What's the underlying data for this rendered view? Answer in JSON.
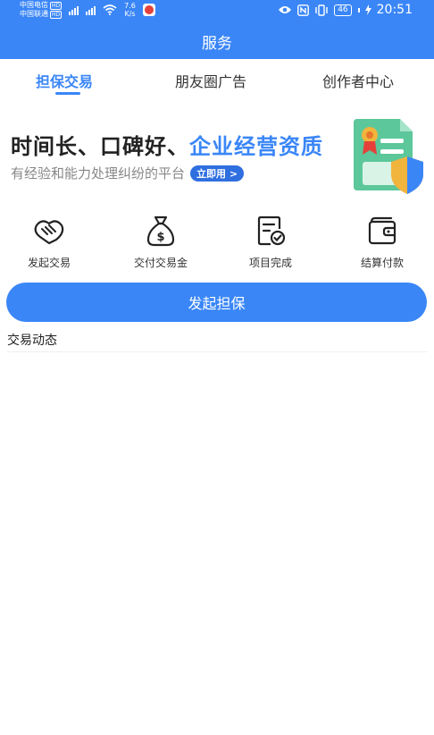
{
  "status_bar": {
    "carrier_1": "中国电信",
    "carrier_2": "中国联通",
    "hd_badge": "HD",
    "net_speed_value": "7.6",
    "net_speed_unit": "K/s",
    "battery": "46",
    "time": "20:51"
  },
  "header": {
    "title": "服务"
  },
  "tabs": [
    {
      "label": "担保交易",
      "active": true
    },
    {
      "label": "朋友圈广告",
      "active": false
    },
    {
      "label": "创作者中心",
      "active": false
    }
  ],
  "banner": {
    "title_part1": "时间长、口碑好、",
    "title_highlight": "企业经营资质",
    "subtitle": "有经验和能力处理纠纷的平台",
    "cta": "立即用 >"
  },
  "actions": [
    {
      "label": "发起交易",
      "icon": "handshake-icon"
    },
    {
      "label": "交付交易金",
      "icon": "money-bag-icon"
    },
    {
      "label": "项目完成",
      "icon": "document-check-icon"
    },
    {
      "label": "结算付款",
      "icon": "wallet-icon"
    }
  ],
  "primary_button": "发起担保",
  "section": {
    "title": "交易动态"
  },
  "colors": {
    "accent": "#3a86f7",
    "badge_red": "#e5413a",
    "art_green": "#5cc79a",
    "art_gold": "#f1b43c"
  }
}
